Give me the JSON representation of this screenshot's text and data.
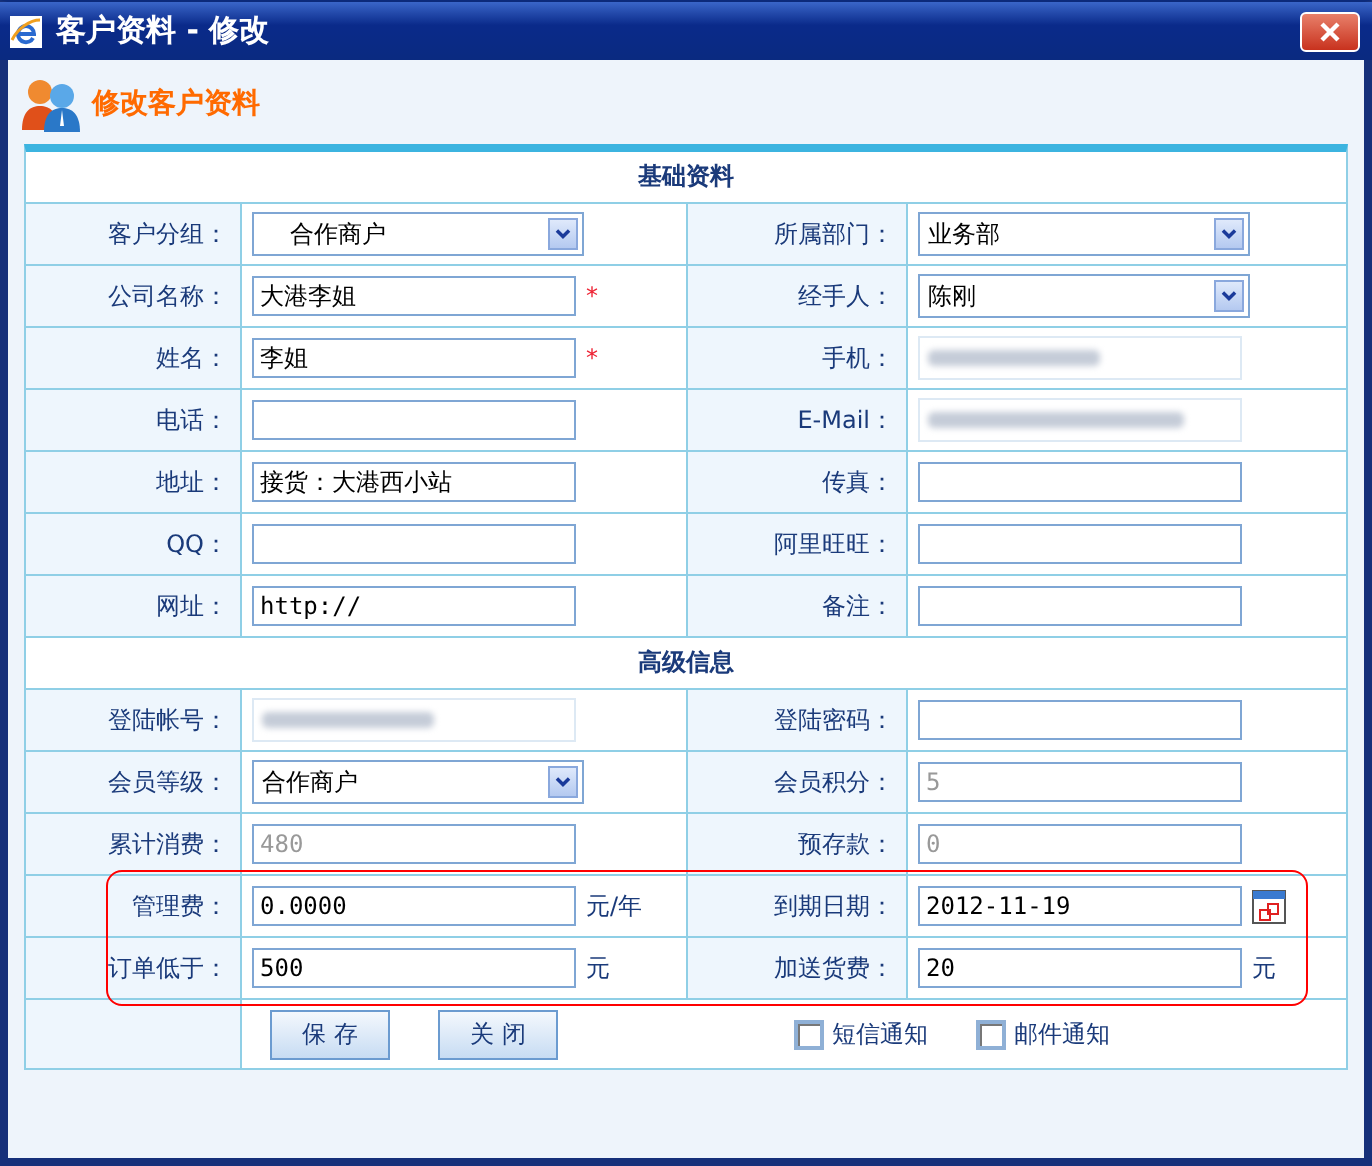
{
  "window": {
    "title": "客户资料 - 修改"
  },
  "header": {
    "title": "修改客户资料"
  },
  "sections": [
    {
      "title": "基础资料",
      "rows": [
        [
          {
            "label": "客户分组：",
            "kind": "select",
            "value": "合作商户"
          },
          {
            "label": "所属部门：",
            "kind": "select",
            "value": "业务部"
          }
        ],
        [
          {
            "label": "公司名称：",
            "kind": "text",
            "value": "大港李姐",
            "required": "*"
          },
          {
            "label": "经手人：",
            "kind": "select",
            "value": "陈刚"
          }
        ],
        [
          {
            "label": "姓名：",
            "kind": "text",
            "value": "李姐",
            "required": "*"
          },
          {
            "label": "手机：",
            "kind": "redacted"
          }
        ],
        [
          {
            "label": "电话：",
            "kind": "text"
          },
          {
            "label": "E-Mail：",
            "kind": "redacted"
          }
        ],
        [
          {
            "label": "地址：",
            "kind": "text",
            "value": "接货：大港西小站"
          },
          {
            "label": "传真：",
            "kind": "text"
          }
        ],
        [
          {
            "label": "QQ：",
            "kind": "text"
          },
          {
            "label": "阿里旺旺：",
            "kind": "text"
          }
        ],
        [
          {
            "label": "网址：",
            "kind": "text",
            "value": "http://"
          },
          {
            "label": "备注：",
            "kind": "text"
          }
        ]
      ]
    },
    {
      "title": "高级信息",
      "rows": [
        [
          {
            "label": "登陆帐号：",
            "kind": "redacted"
          },
          {
            "label": "登陆密码：",
            "kind": "text"
          }
        ],
        [
          {
            "label": "会员等级：",
            "kind": "select",
            "value": "合作商户"
          },
          {
            "label": "会员积分：",
            "kind": "text",
            "value": "5",
            "disabled": true
          }
        ],
        [
          {
            "label": "累计消费：",
            "kind": "text",
            "value": "480",
            "disabled": true
          },
          {
            "label": "预存款：",
            "kind": "text",
            "value": "0",
            "disabled": true
          }
        ],
        [
          {
            "label": "管理费：",
            "kind": "text",
            "value": "0.0000",
            "suffix": "元/年",
            "highlighted": true
          },
          {
            "label": "到期日期：",
            "kind": "date",
            "value": "2012-11-19"
          }
        ],
        [
          {
            "label": "订单低于：",
            "kind": "text",
            "value": "500",
            "suffix": "元",
            "highlighted": true
          },
          {
            "label": "加送货费：",
            "kind": "text",
            "value": "20",
            "suffix": "元"
          }
        ]
      ]
    }
  ],
  "buttons": [
    "保 存",
    "关 闭"
  ],
  "options": [
    {
      "label": "短信通知",
      "checked": false
    },
    {
      "label": "邮件通知",
      "checked": false
    }
  ]
}
